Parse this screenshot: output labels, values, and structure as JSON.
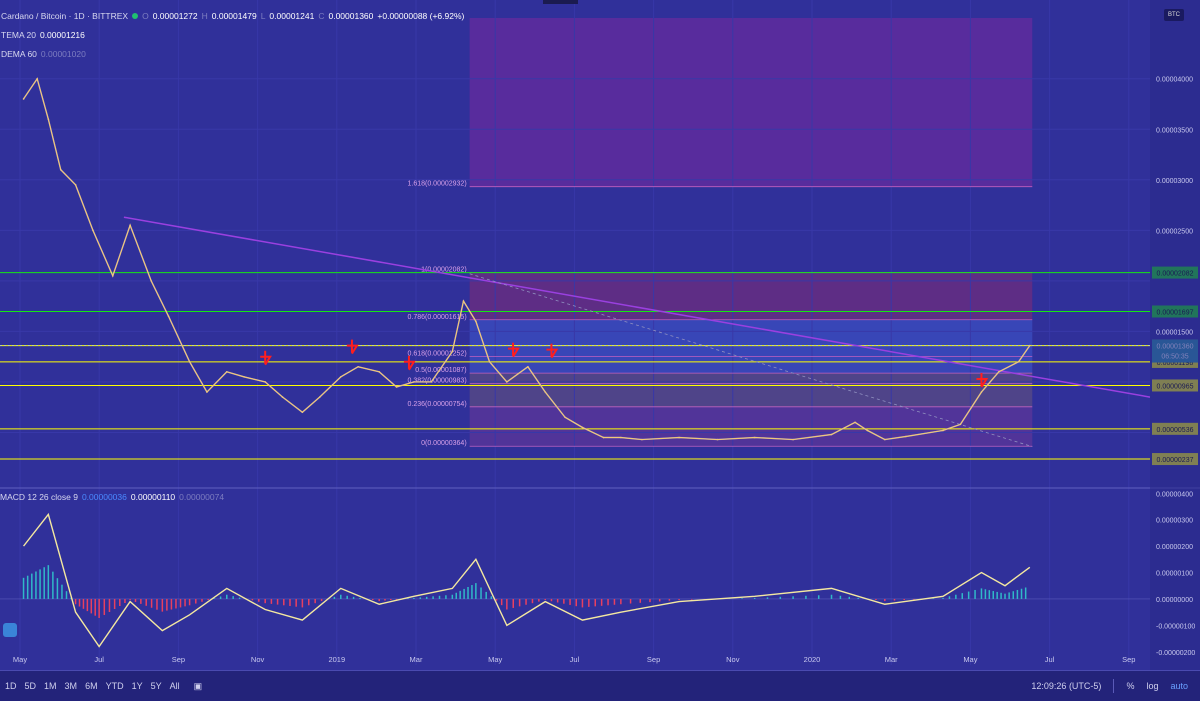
{
  "header": {
    "symbol_title": "Cardano / Bitcoin · 1D · BITTREX",
    "ohlc": {
      "o_label": "O",
      "o": "0.00001272",
      "h_label": "H",
      "h": "0.00001479",
      "l_label": "L",
      "l": "0.00001241",
      "c_label": "C",
      "c": "0.00001360",
      "change": "+0.00000088 (+6.92%)"
    },
    "indicators": [
      {
        "name": "TEMA 20",
        "value": "0.00001216"
      },
      {
        "name": "DEMA 60",
        "value": "0.00001020"
      }
    ],
    "corner_badge": "BTC"
  },
  "macd_legend": {
    "name": "MACD 12 26 close 9",
    "v1": "0.00000036",
    "v2": "0.00000110",
    "v3": "0.00000074"
  },
  "chart_data": {
    "type": "line",
    "series_name": "ADA/BTC",
    "x": [
      "2018-04-20",
      "2018-05-01",
      "2018-05-10",
      "2018-05-20",
      "2018-06-01",
      "2018-06-15",
      "2018-07-01",
      "2018-07-15",
      "2018-08-01",
      "2018-08-15",
      "2018-09-01",
      "2018-09-15",
      "2018-10-01",
      "2018-10-15",
      "2018-11-01",
      "2018-11-15",
      "2018-12-01",
      "2018-12-15",
      "2019-01-01",
      "2019-01-15",
      "2019-02-01",
      "2019-02-15",
      "2019-03-01",
      "2019-03-15",
      "2019-04-01",
      "2019-04-10",
      "2019-04-20",
      "2019-05-01",
      "2019-05-15",
      "2019-06-01",
      "2019-06-15",
      "2019-07-01",
      "2019-07-15",
      "2019-08-01",
      "2019-08-15",
      "2019-09-01",
      "2019-10-01",
      "2019-11-01",
      "2019-12-01",
      "2020-01-01",
      "2020-02-01",
      "2020-02-20",
      "2020-03-01",
      "2020-03-15",
      "2020-04-01",
      "2020-05-01",
      "2020-05-15",
      "2020-06-01",
      "2020-06-15",
      "2020-07-01",
      "2020-07-10"
    ],
    "y": [
      3.8e-05,
      4e-05,
      3.6e-05,
      3.1e-05,
      2.95e-05,
      2.5e-05,
      2.05e-05,
      2.55e-05,
      2e-05,
      1.65e-05,
      1.2e-05,
      9e-06,
      1.1e-05,
      1.05e-05,
      1e-05,
      8.5e-06,
      7e-06,
      8.5e-06,
      1.05e-05,
      1.15e-05,
      1.1e-05,
      9.5e-06,
      1e-05,
      1e-05,
      1.3e-05,
      1.8e-05,
      1.6e-05,
      1.2e-05,
      1e-05,
      1.15e-05,
      9e-06,
      6.5e-06,
      5.5e-06,
      4.5e-06,
      4.5e-06,
      4.3e-06,
      4.5e-06,
      4.3e-06,
      4.5e-06,
      4.3e-06,
      4.8e-06,
      6e-06,
      5.2e-06,
      4.3e-06,
      4.6e-06,
      5.2e-06,
      5.8e-06,
      9e-06,
      1.1e-05,
      1.2e-05,
      1.36e-05
    ],
    "ylim": [
      0.0,
      4.7e-05
    ],
    "y_ticks": [
      "0.00004000",
      "0.00003500",
      "0.00003000",
      "0.00002500",
      "0.00001500"
    ],
    "x_ticks": [
      "May",
      "Jul",
      "Sep",
      "Nov",
      "2019",
      "Mar",
      "May",
      "Jul",
      "Sep",
      "Nov",
      "2020",
      "Mar",
      "May",
      "Jul",
      "Sep"
    ],
    "levels": [
      {
        "label": "0.00002082",
        "value": 2.082e-05,
        "color": "#14e614",
        "text": "#000000"
      },
      {
        "label": "0.00001697",
        "value": 1.697e-05,
        "color": "#14e614",
        "text": "#000000"
      },
      {
        "label": "0.00001359",
        "value": 1.359e-05,
        "color": "#ffff00",
        "text": "#000000"
      },
      {
        "label": "0.00001198",
        "value": 1.198e-05,
        "color": "#ffff00",
        "text": "#000000"
      },
      {
        "label": "0.00000965",
        "value": 9.65e-06,
        "color": "#ffff00",
        "text": "#000000"
      },
      {
        "label": "0.00000536",
        "value": 5.36e-06,
        "color": "#ffff00",
        "text": "#000000"
      },
      {
        "label": "0.00000237",
        "value": 2.37e-06,
        "color": "#ffff00",
        "text": "#000000"
      }
    ],
    "current_price": {
      "label": "0.00001360",
      "value": 1.36e-05,
      "countdown": "06:50:35",
      "color": "#2a9aa8"
    },
    "fib_levels": [
      {
        "label": "1.618(0.00002932)",
        "value": 2.932e-05
      },
      {
        "label": "1(0.00002082)",
        "value": 2.082e-05
      },
      {
        "label": "0.786(0.00001615)",
        "value": 1.615e-05
      },
      {
        "label": "0.618(0.00001252)",
        "value": 1.252e-05
      },
      {
        "label": "0.5(0.00001087)",
        "value": 1.087e-05
      },
      {
        "label": "0.382(0.00000983)",
        "value": 9.83e-06
      },
      {
        "label": "0.236(0.00000754)",
        "value": 7.54e-06
      },
      {
        "label": "0(0.00000364)",
        "value": 3.64e-06
      }
    ],
    "macd": {
      "y_ticks": [
        "0.00000400",
        "0.00000300",
        "0.00000200",
        "0.00000100",
        "0.00000000",
        "-0.00000100",
        "-0.00000200"
      ],
      "ylim": [
        -2.5e-06,
        4.2e-06
      ],
      "x": [
        "2018-04-20",
        "2018-05-10",
        "2018-06-01",
        "2018-06-20",
        "2018-07-15",
        "2018-08-10",
        "2018-09-01",
        "2018-10-01",
        "2018-11-01",
        "2018-12-01",
        "2019-01-01",
        "2019-02-01",
        "2019-03-01",
        "2019-04-01",
        "2019-04-20",
        "2019-05-15",
        "2019-06-15",
        "2019-07-15",
        "2019-08-15",
        "2019-10-01",
        "2019-12-01",
        "2020-02-01",
        "2020-03-15",
        "2020-05-01",
        "2020-06-01",
        "2020-06-20",
        "2020-07-10"
      ],
      "y": [
        2e-06,
        3.2e-06,
        -5e-07,
        -1.8e-06,
        -1e-07,
        -1.2e-06,
        -6e-07,
        4e-07,
        -4e-07,
        -8e-07,
        4e-07,
        -2e-07,
        1e-07,
        4e-07,
        1.5e-06,
        -1e-06,
        -1e-07,
        -8e-07,
        -5e-07,
        -1e-07,
        1e-07,
        4e-07,
        -2e-07,
        1e-07,
        1e-06,
        5e-07,
        1.2e-06
      ]
    }
  },
  "bottombar": {
    "timeframes": [
      "1D",
      "5D",
      "1M",
      "3M",
      "6M",
      "YTD",
      "1Y",
      "5Y",
      "All"
    ],
    "clock": "12:09:26 (UTC-5)",
    "pct": "%",
    "log": "log",
    "auto": "auto"
  },
  "colors": {
    "background": "#30309a",
    "price": "#f0c878",
    "trendline": "#9a40e0",
    "arrow": "#ff1e1e"
  }
}
